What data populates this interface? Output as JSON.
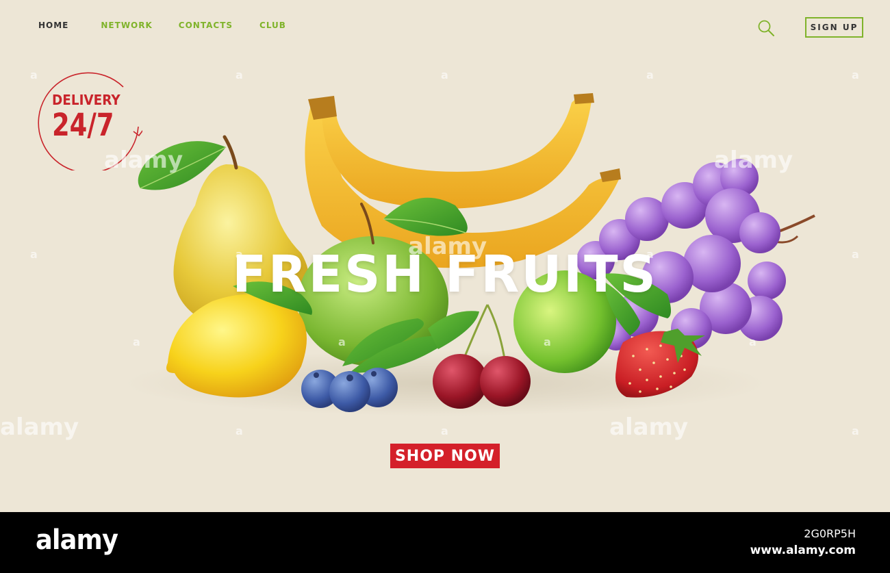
{
  "nav": {
    "home": "HOME",
    "network": "NETWORK",
    "contacts": "CONTACTS",
    "club": "CLUB"
  },
  "header": {
    "signup_label": "SIGN UP",
    "search_icon": "search-icon"
  },
  "badge": {
    "line1": "DELIVERY",
    "line2": "24/7"
  },
  "hero": {
    "headline": "FRESH FRUITS",
    "cta_label": "SHOP NOW"
  },
  "watermark": {
    "text": "alamy",
    "small": "a"
  },
  "footer": {
    "logo": "alamy",
    "image_id": "2G0RP5H",
    "url": "www.alamy.com"
  },
  "colors": {
    "background": "#ede6d6",
    "accent_green": "#7fb32a",
    "accent_red": "#d4202a",
    "bar": "#000000"
  }
}
